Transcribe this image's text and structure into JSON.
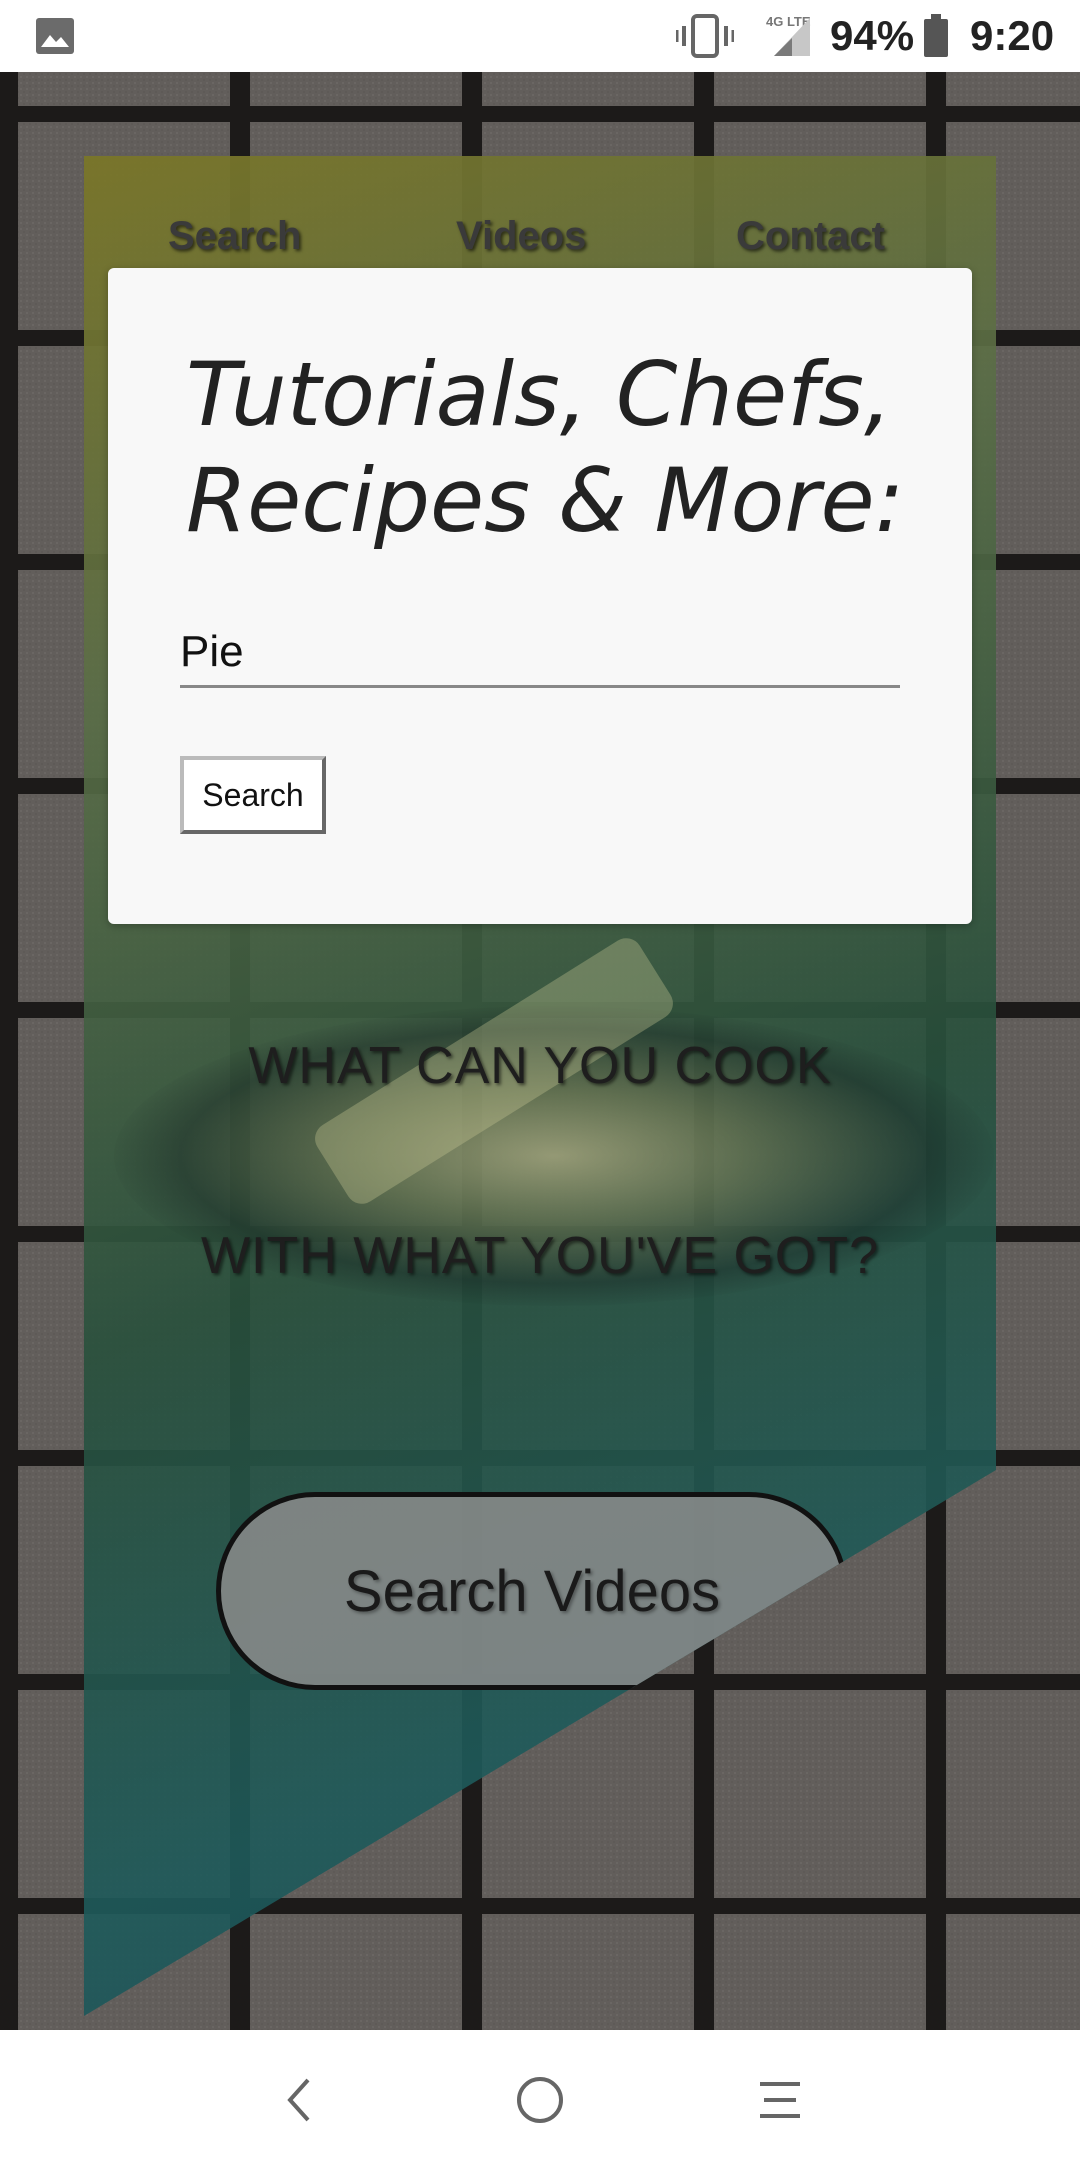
{
  "status_bar": {
    "battery_percent": "94%",
    "time": "9:20",
    "network_label": "4G LTE",
    "icons": [
      "gallery-icon",
      "vibrate-icon",
      "signal-icon",
      "battery-icon"
    ]
  },
  "hero": {
    "nav": [
      "Search",
      "Videos",
      "Contact"
    ],
    "tagline_line1": "WHAT CAN YOU COOK",
    "tagline_line2": "WITH WHAT YOU'VE GOT?",
    "cta_label": "Search Videos"
  },
  "modal": {
    "heading": "Tutorials, Chefs, Recipes & More:",
    "search_value": "Pie",
    "search_button": "Search"
  },
  "system_nav": {
    "icons": [
      "back-icon",
      "home-icon",
      "menu-icon"
    ]
  },
  "colors": {
    "modal_bg": "#f8f8f8",
    "overlay_green": "#1e5a50",
    "overlay_olive": "#7a7628"
  }
}
